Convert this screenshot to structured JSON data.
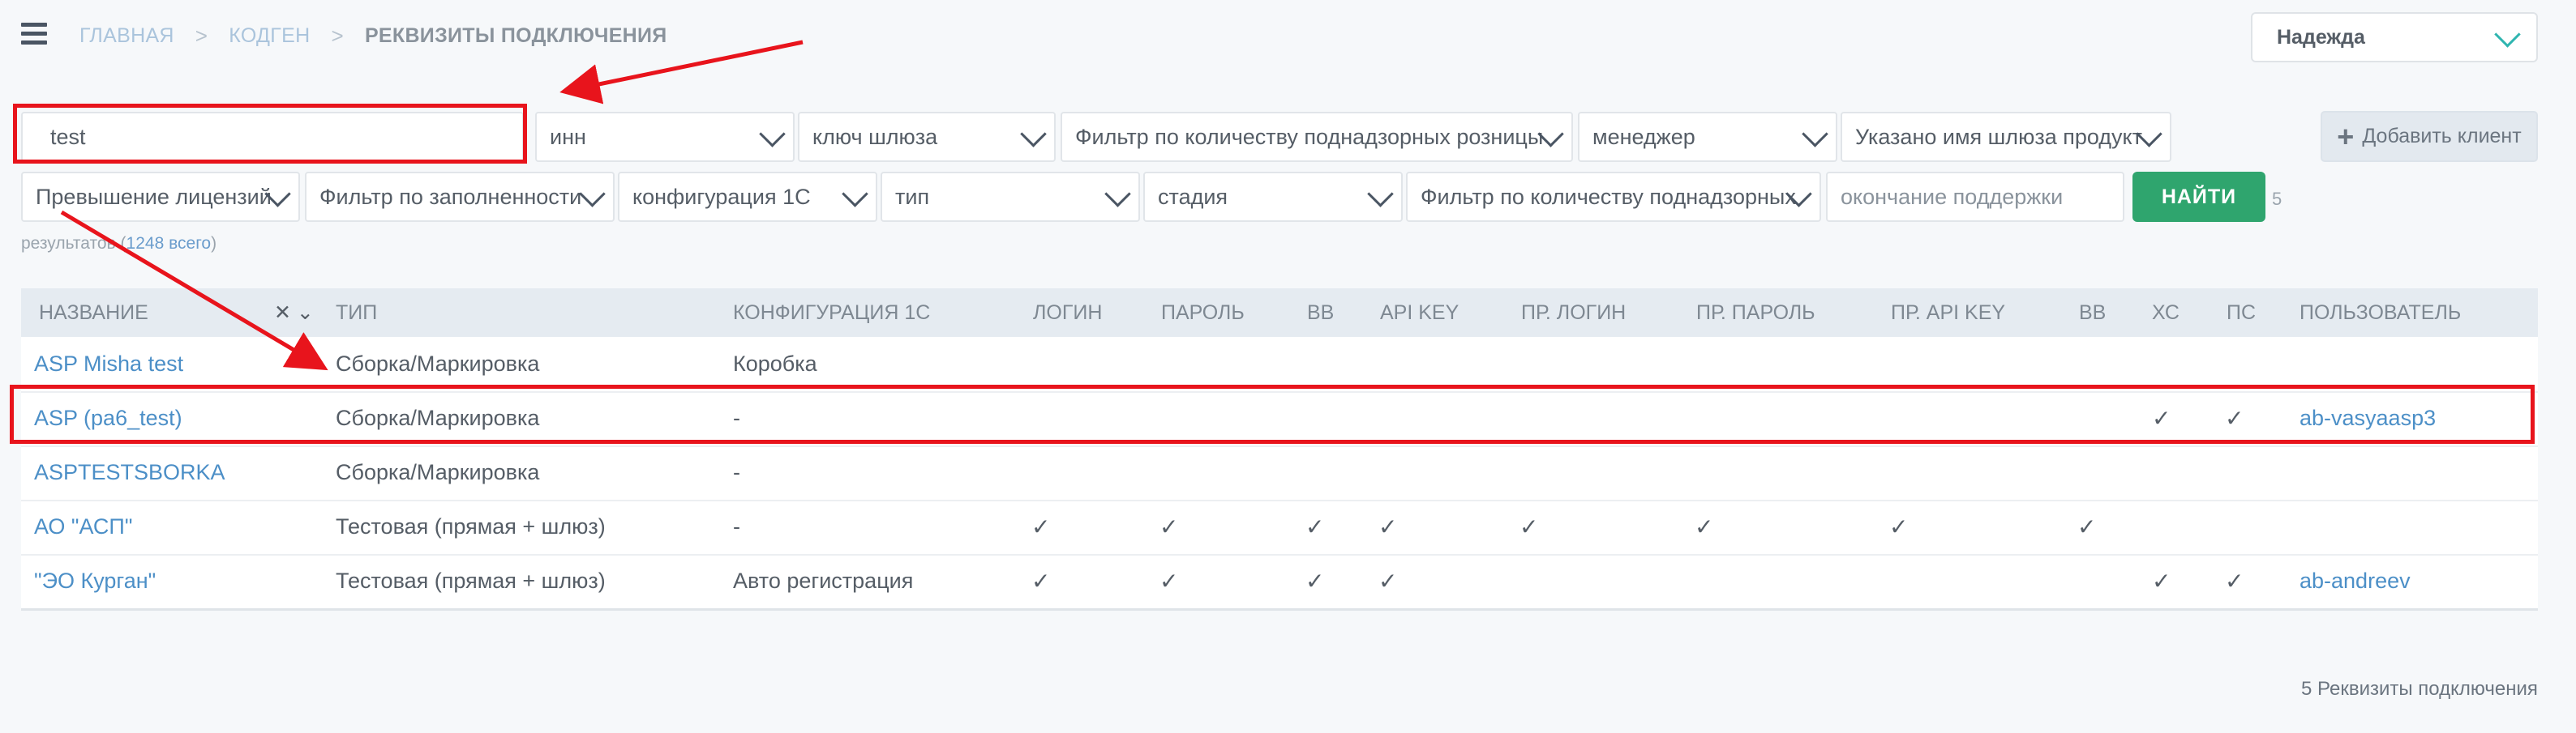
{
  "breadcrumb": {
    "home": "ГЛАВНАЯ",
    "section": "КОДГЕН",
    "current": "РЕКВИЗИТЫ ПОДКЛЮЧЕНИЯ",
    "separator": ">"
  },
  "user_menu": {
    "name": "Надежда"
  },
  "filters": {
    "search_value": "test",
    "row1": [
      "инн",
      "ключ шлюза",
      "Фильтр по количеству поднадзорных розницы",
      "менеджер",
      "Указано имя шлюза продукт"
    ],
    "row2": [
      "Превышение лицензий",
      "Фильтр по заполненности",
      "конфигурация 1С",
      "тип",
      "стадия",
      "Фильтр по количеству поднадзорных"
    ],
    "support_end_placeholder": "окончание поддержки",
    "find_label": "НАЙТИ",
    "add_client_label": "Добавить клиент"
  },
  "results": {
    "count": "5",
    "label": "результатов",
    "total": "1248 всего",
    "paren_open": "(",
    "paren_close": ")"
  },
  "table": {
    "columns": [
      "НАЗВАНИЕ",
      "ТИП",
      "КОНФИГУРАЦИЯ 1С",
      "ЛОГИН",
      "ПАРОЛЬ",
      "ВВ",
      "API KEY",
      "ПР. ЛОГИН",
      "ПР. ПАРОЛЬ",
      "ПР. API KEY",
      "ВВ",
      "ХС",
      "ПС",
      "ПОЛЬЗОВАТЕЛЬ"
    ],
    "sort_control": "✕ ⌄",
    "check_mark": "✓",
    "rows": [
      {
        "name": "ASP Misha test",
        "type": "Сборка/Маркировка",
        "config": "Коробка",
        "user": ""
      },
      {
        "name": "ASP (ра6_test)",
        "type": "Сборка/Маркировка",
        "config": "-",
        "user": "ab-vasyaasp3"
      },
      {
        "name": "ASPTESTSBORKA",
        "type": "Сборка/Маркировка",
        "config": "-",
        "user": ""
      },
      {
        "name": "АО \"АСП\"",
        "type": "Тестовая (прямая + шлюз)",
        "config": "-",
        "user": ""
      },
      {
        "name": "\"ЭО Курган\"",
        "type": "Тестовая (прямая + шлюз)",
        "config": "Авто регистрация",
        "user": "ab-andreev"
      }
    ]
  },
  "footer": {
    "summary": "5 Реквизиты подключения"
  },
  "colors": {
    "annotation": "#e8141c",
    "link": "#4c8fc7",
    "primary_button": "#2fa56e",
    "accent_chevron": "#2fb5b0"
  }
}
